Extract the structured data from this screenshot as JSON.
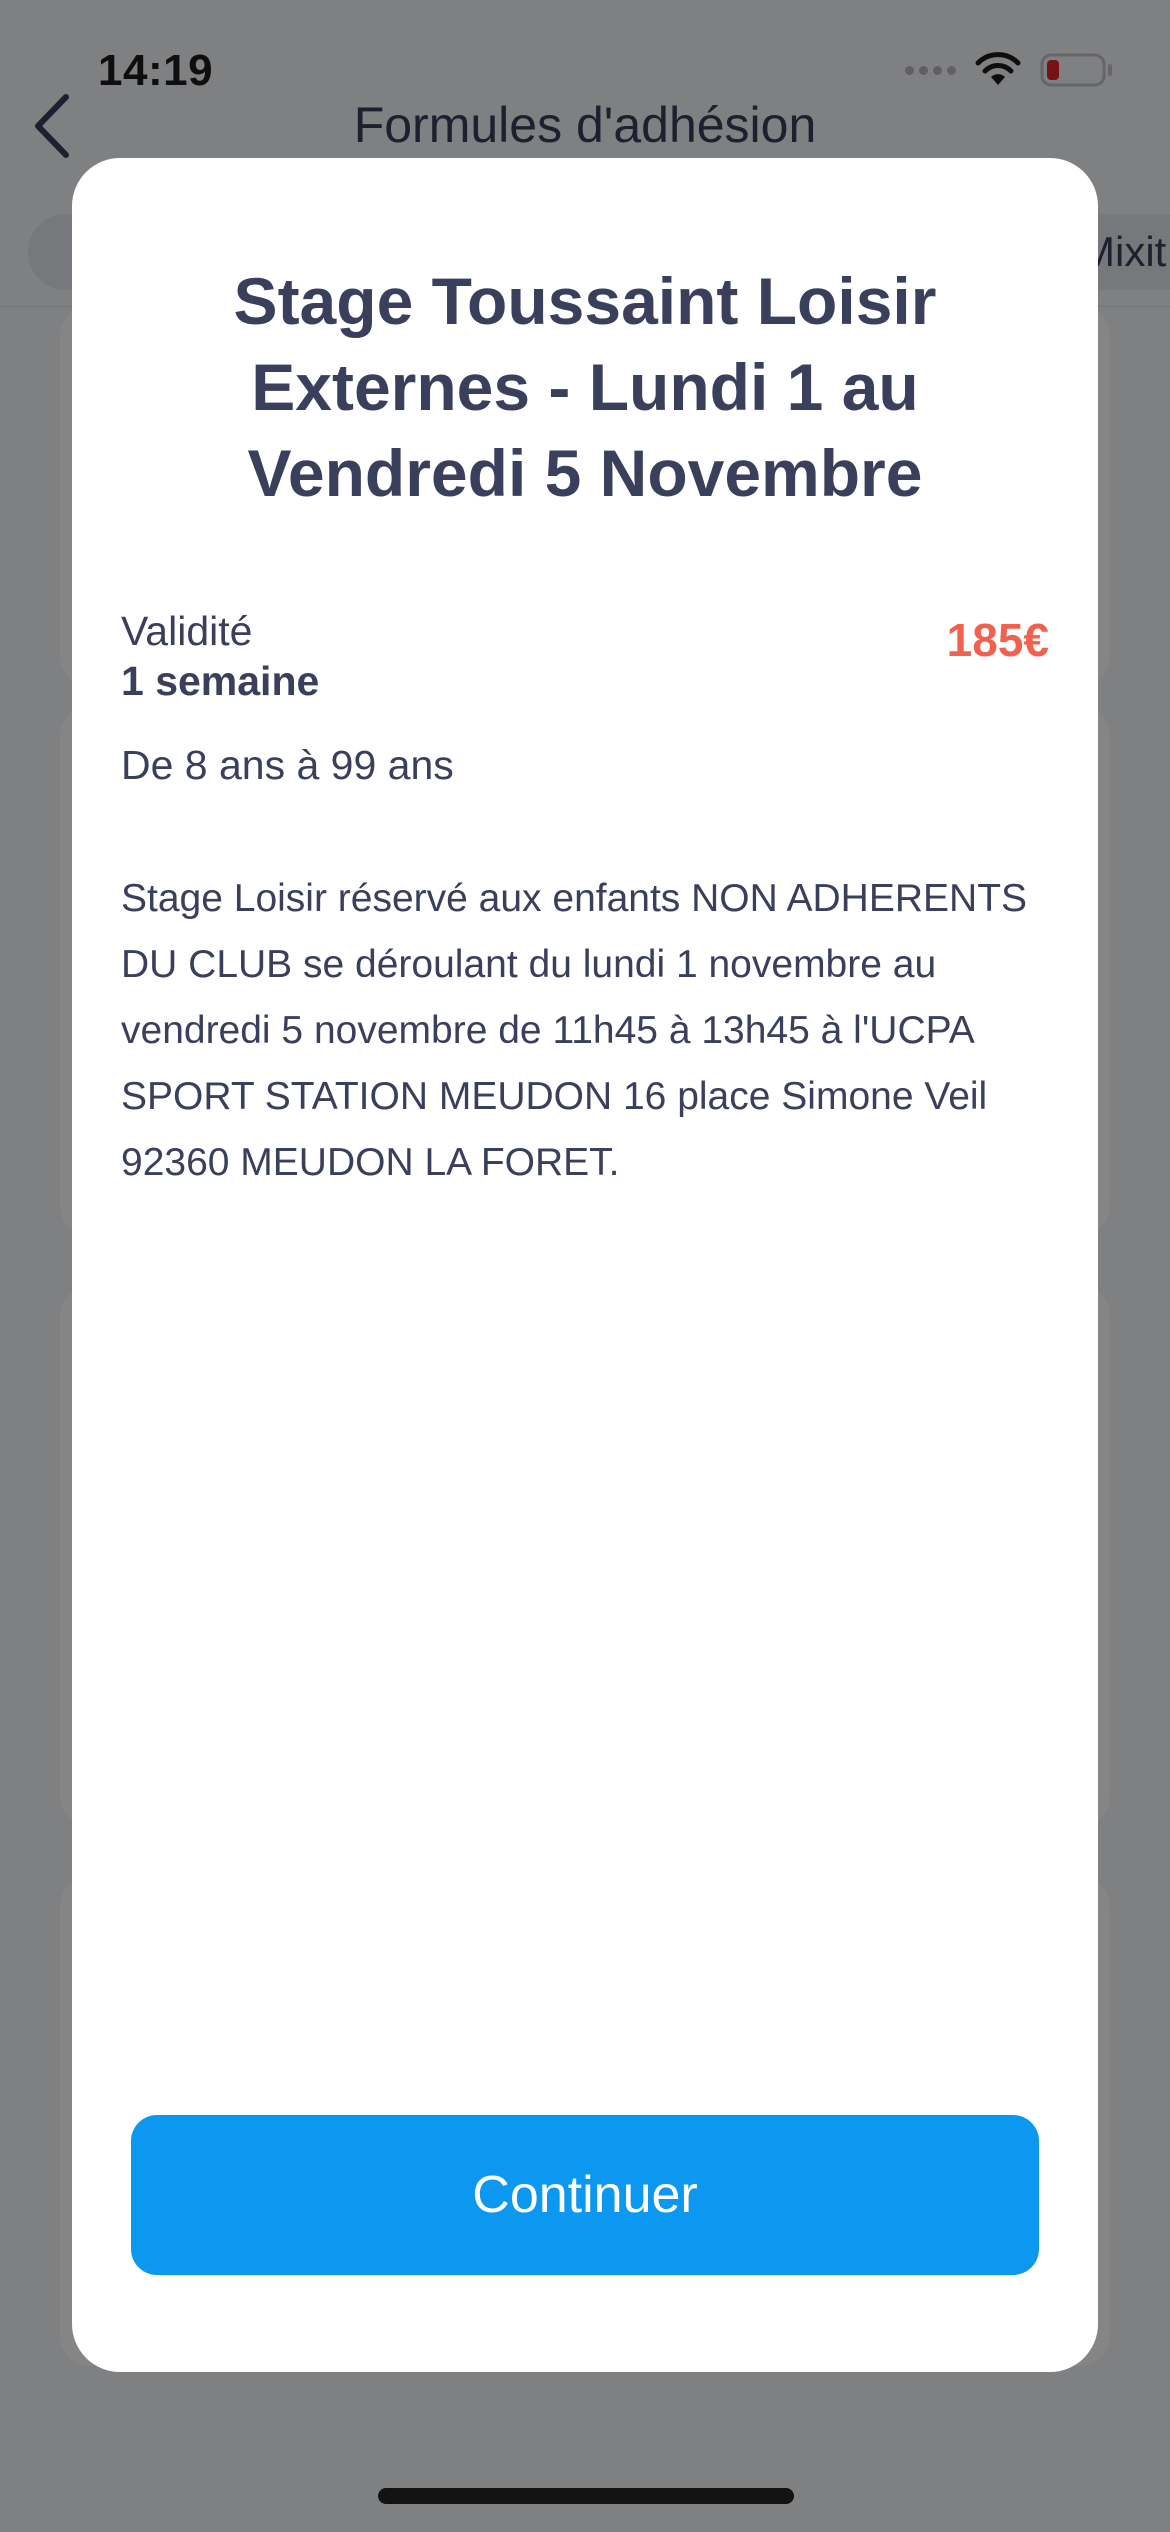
{
  "status_bar": {
    "time": "14:19",
    "battery_color": "#e0252b"
  },
  "nav": {
    "title": "Formules d'adhésion"
  },
  "filters": {
    "right_chip_label": "Mixit"
  },
  "modal": {
    "title": "Stage Toussaint Loisir Externes - Lundi 1 au Vendredi 5 Novembre",
    "validity_label": "Validité",
    "validity_value": "1 semaine",
    "price": "185€",
    "age_range": "De 8 ans à 99 ans",
    "description": "Stage Loisir réservé aux enfants NON ADHERENTS DU CLUB se déroulant du lundi 1 novembre au vendredi 5 novembre de 11h45 à 13h45 à l'UCPA SPORT STATION MEUDON 16 place Simone Veil 92360 MEUDON LA FORET.",
    "continue_label": "Continuer"
  },
  "colors": {
    "text": "#3a3f5c",
    "price": "#f0614f",
    "button": "#0c97f0"
  }
}
